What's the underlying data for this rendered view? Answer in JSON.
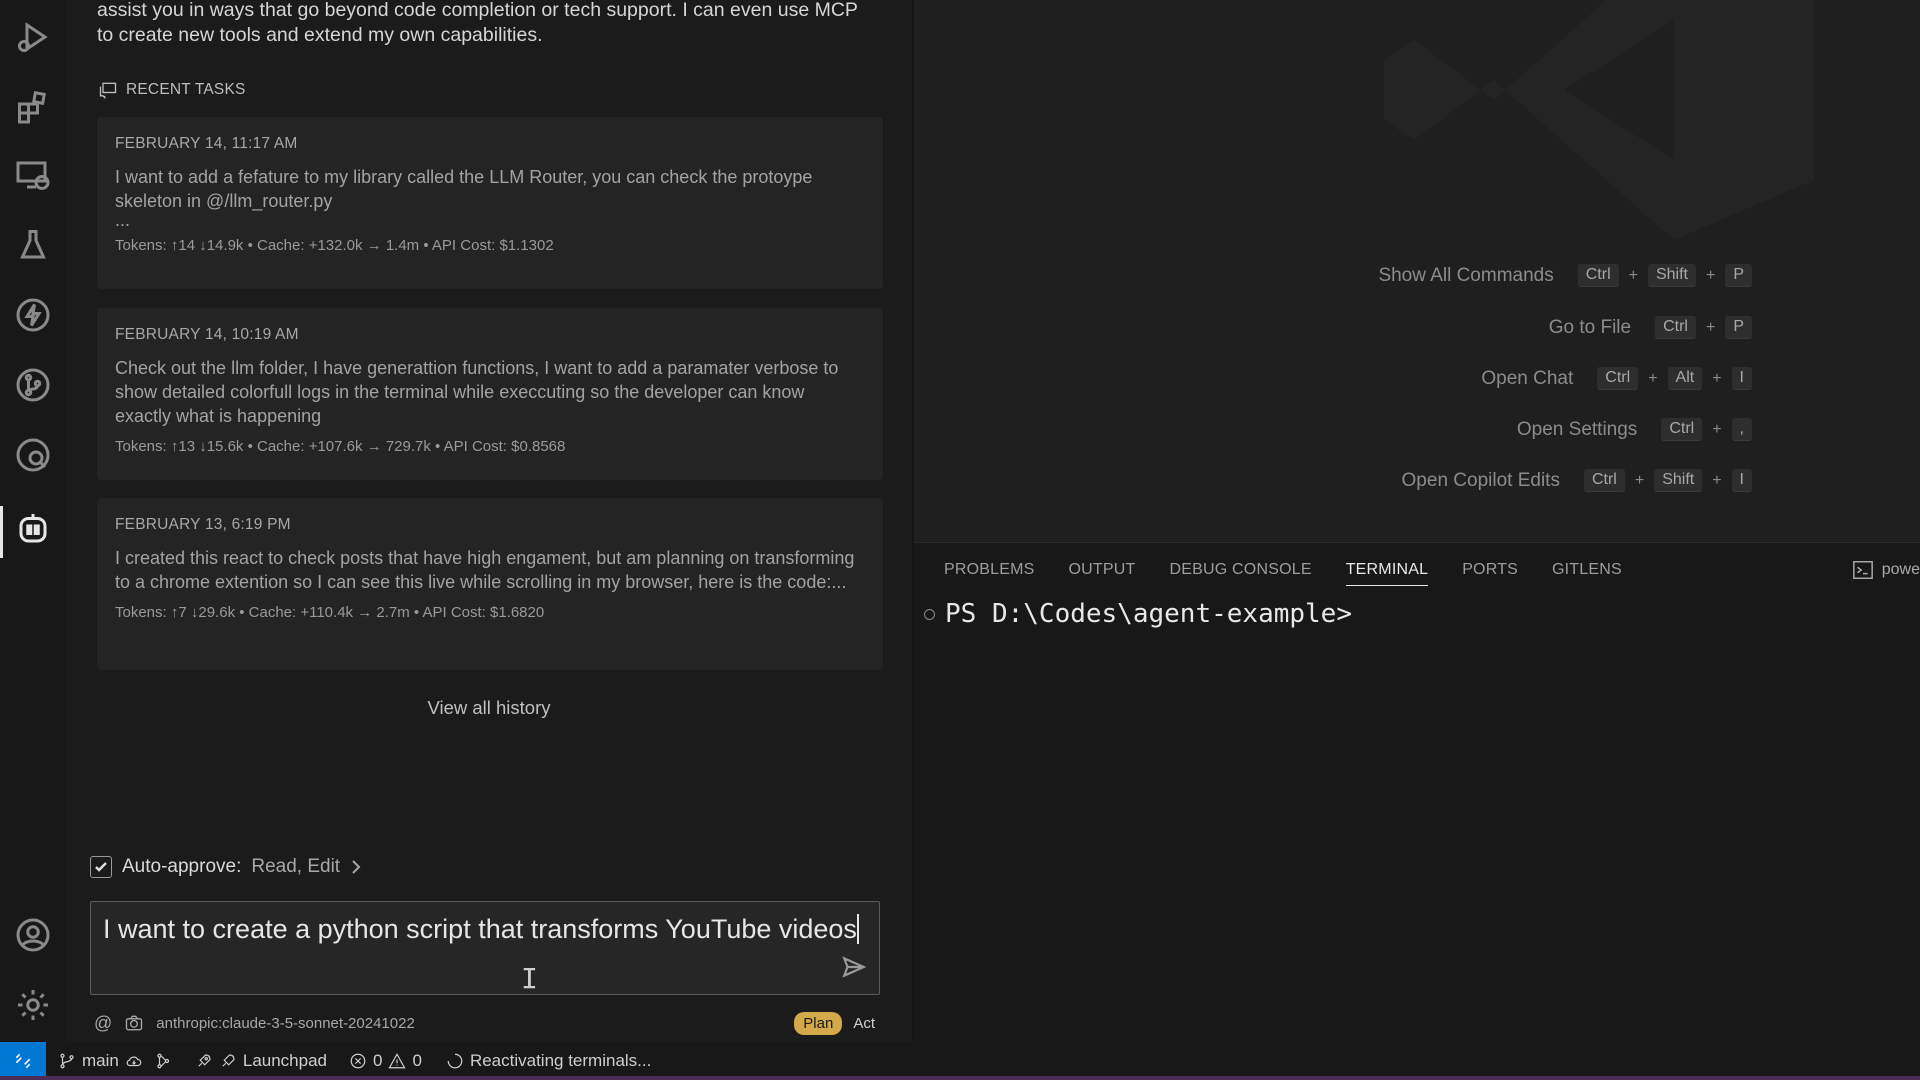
{
  "panel": {
    "intro_text": "assist you in ways that go beyond code completion or tech support. I can even use MCP to create new tools and extend my own capabilities.",
    "recent_tasks_heading": "RECENT TASKS",
    "tasks": [
      {
        "date": "FEBRUARY 14, 11:17 AM",
        "text": "I want to add a fefature to my library called the LLM Router, you can check the protoype skeleton in @/llm_router.py",
        "ellipsis": "...",
        "meta": "Tokens: ↑14 ↓14.9k • Cache: +132.0k → 1.4m • API Cost: $1.1302"
      },
      {
        "date": "FEBRUARY 14, 10:19 AM",
        "text": "Check out the llm folder, I have generattion functions, I want to add a paramater verbose to show detailed colorfull logs in the terminal while execcuting so the developer can know exactly what is happening",
        "meta": "Tokens: ↑13 ↓15.6k • Cache: +107.6k → 729.7k • API Cost: $0.8568"
      },
      {
        "date": "FEBRUARY 13, 6:19 PM",
        "text": "I created this react to check posts that have high engament, but am planning on transforming to a chrome extention so I can see this live while scrolling in my browser, here is the code:...",
        "meta": "Tokens: ↑7 ↓29.6k • Cache: +110.4k → 2.7m • API Cost: $1.6820"
      }
    ],
    "view_all": "View all history",
    "auto_approve_label": "Auto-approve:",
    "auto_approve_value": "Read, Edit",
    "input_text": "I want to create a python script that transforms YouTube videos",
    "model": "anthropic:claude-3-5-sonnet-20241022",
    "mode_plan": "Plan",
    "mode_act": "Act",
    "at_symbol": "@"
  },
  "editor": {
    "shortcuts": [
      {
        "label": "Show All Commands",
        "keys": [
          "Ctrl",
          "Shift",
          "P"
        ]
      },
      {
        "label": "Go to File",
        "keys": [
          "Ctrl",
          "P"
        ]
      },
      {
        "label": "Open Chat",
        "keys": [
          "Ctrl",
          "Alt",
          "I"
        ]
      },
      {
        "label": "Open Settings",
        "keys": [
          "Ctrl",
          ","
        ]
      },
      {
        "label": "Open Copilot Edits",
        "keys": [
          "Ctrl",
          "Shift",
          "I"
        ]
      }
    ]
  },
  "terminal": {
    "tabs": [
      "PROBLEMS",
      "OUTPUT",
      "DEBUG CONSOLE",
      "TERMINAL",
      "PORTS",
      "GITLENS"
    ],
    "active_tab": "TERMINAL",
    "shell_label": "powe",
    "prompt": "PS D:\\Codes\\agent-example>"
  },
  "statusbar": {
    "branch": "main",
    "launchpad": "Launchpad",
    "errors": "0",
    "warnings": "0",
    "status_text": "Reactivating terminals..."
  },
  "colors": {
    "accent": "#0078d4",
    "plan_badge": "#d4a94a"
  }
}
